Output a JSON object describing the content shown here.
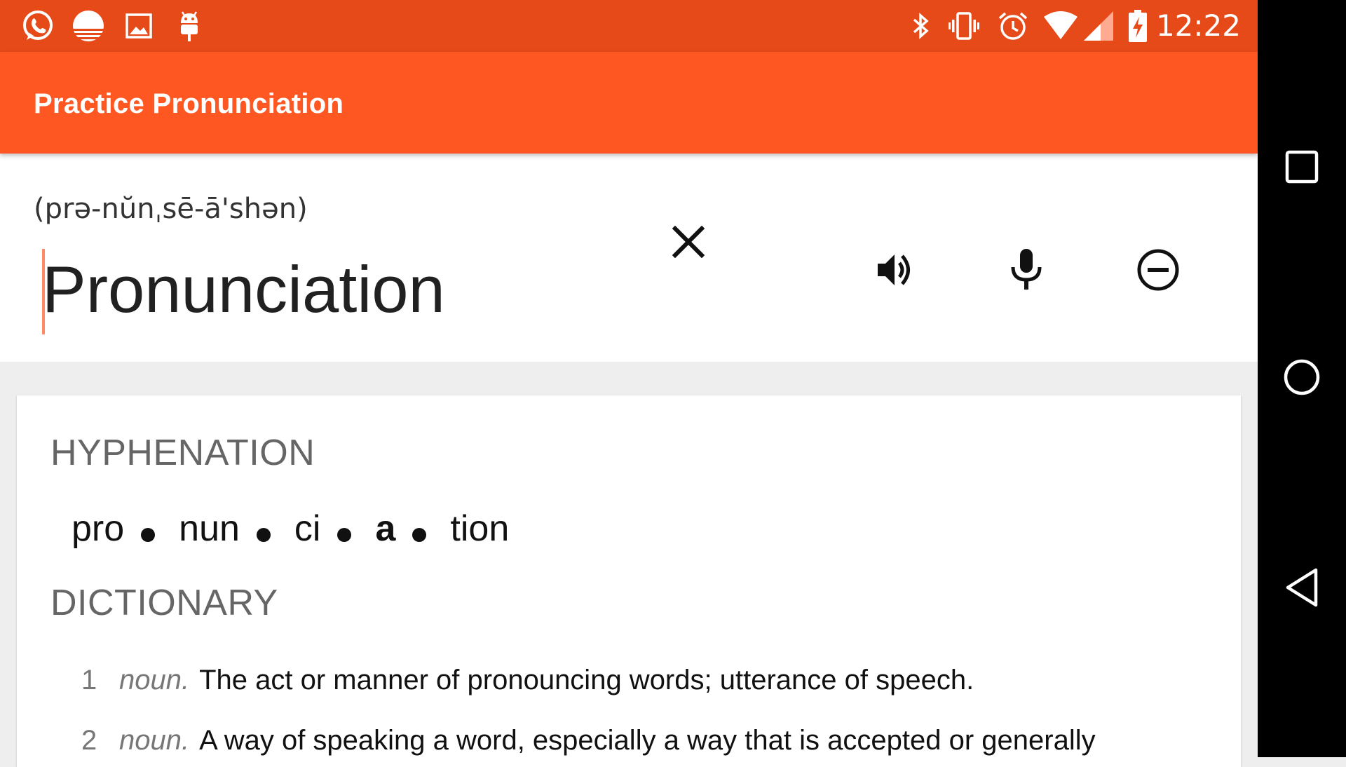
{
  "status_bar": {
    "left_icons": [
      "whatsapp-icon",
      "sunrise-icon",
      "image-icon",
      "android-icon"
    ],
    "right_icons": [
      "bluetooth-icon",
      "vibrate-icon",
      "alarm-icon",
      "wifi-icon",
      "signal-icon",
      "battery-charging-icon"
    ],
    "time": "12:22",
    "background": "#e64a19"
  },
  "app_bar": {
    "title": "Practice Pronunciation",
    "background": "#ff5722"
  },
  "header": {
    "phonetic": "(prə-nŭnˌsē-ā'shən)",
    "word": "Pronunciation",
    "clear_icon": "close-icon",
    "speak_icon": "volume-up-icon",
    "mic_icon": "microphone-icon",
    "remove_icon": "remove-circle-icon",
    "accent": "#ff8a65"
  },
  "card": {
    "hyphenation_title": "HYPHENATION",
    "syllables": [
      "pro",
      "nun",
      "ci",
      "a",
      "tion"
    ],
    "stressed_syllable": "a",
    "dictionary_title": "DICTIONARY",
    "definitions": [
      {
        "num": "1",
        "pos": "noun.",
        "text": "The act or manner of pronouncing words; utterance of speech."
      },
      {
        "num": "2",
        "pos": "noun.",
        "text": "A way of speaking a word, especially a way that is accepted or generally"
      }
    ]
  },
  "nav_bar": {
    "buttons": [
      "recents-square-icon",
      "home-circle-icon",
      "back-triangle-icon"
    ]
  }
}
